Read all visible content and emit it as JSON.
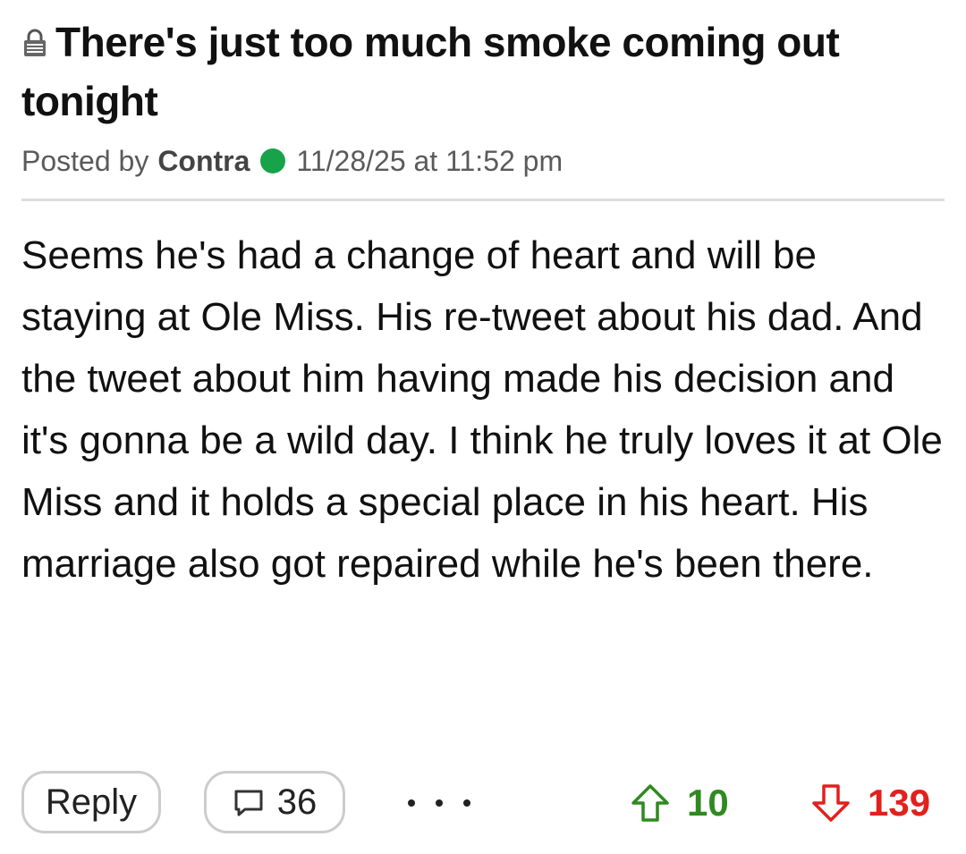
{
  "post": {
    "title": "There's just too much smoke coming out tonight",
    "meta": {
      "posted_by_label": "Posted by",
      "author": "Contra",
      "author_status": "online",
      "timestamp": "11/28/25 at 11:52 pm"
    },
    "body": "Seems he's had a change of heart and will be staying at Ole Miss. His re-tweet about his dad. And the tweet about him having made his decision and it's gonna be a wild day. I think he truly loves it at Ole Miss and it holds a special place in his heart. His marriage also got repaired while he's been there."
  },
  "actions": {
    "reply_label": "Reply",
    "comments_count": "36",
    "more_icon": "ellipsis-icon",
    "upvotes": "10",
    "downvotes": "139"
  },
  "colors": {
    "online": "#17a34a",
    "upvote": "#2f8a1f",
    "downvote": "#e0211d",
    "divider": "#dddddd",
    "button_border": "#cccccc"
  }
}
